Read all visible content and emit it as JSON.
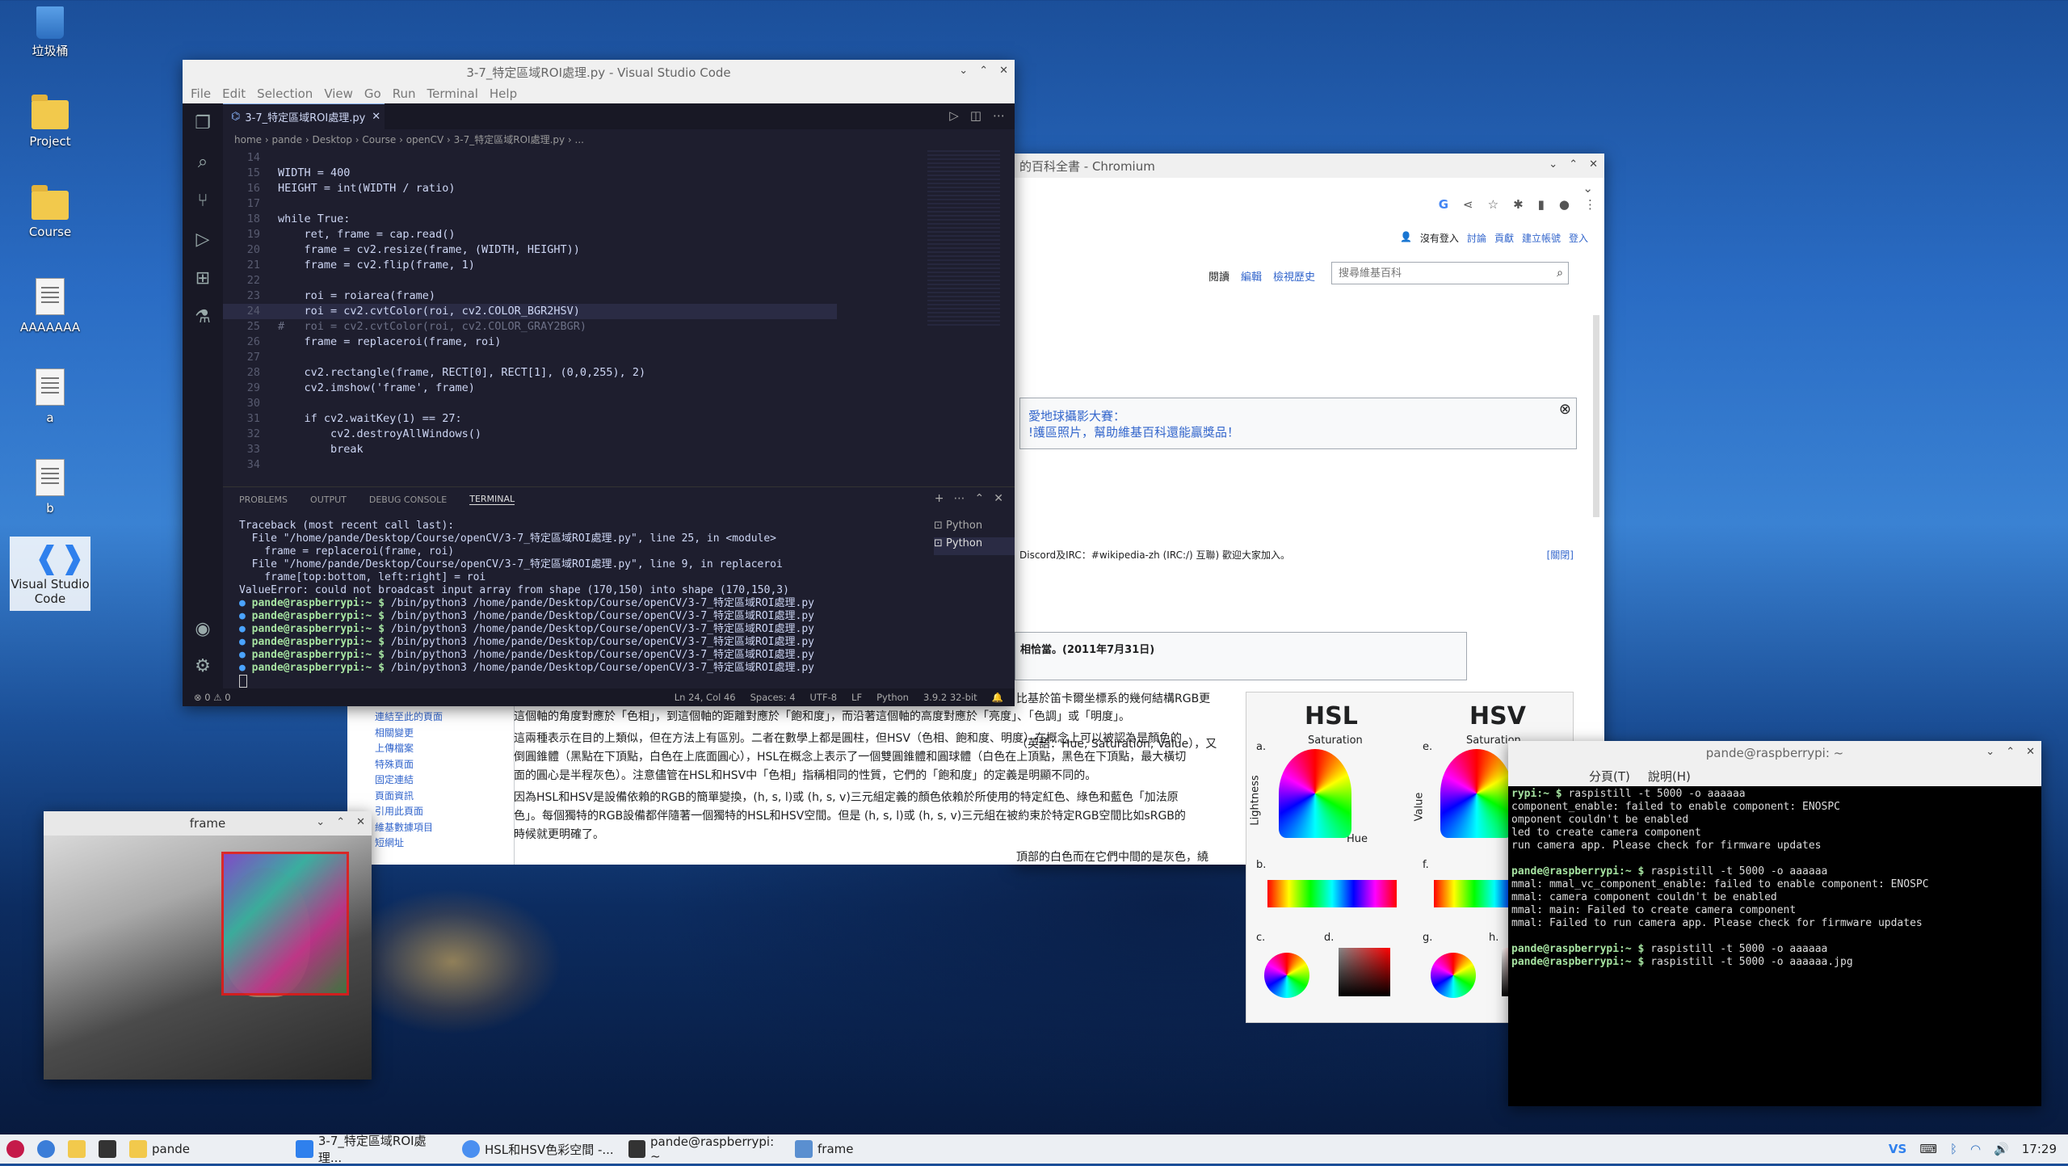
{
  "desktop": {
    "icons": [
      "垃圾桶",
      "Project",
      "Course",
      "AAAAAAA",
      "a",
      "b",
      "Visual Studio Code"
    ]
  },
  "vscode": {
    "title": "3-7_特定區域ROI處理.py - Visual Studio Code",
    "menu": [
      "File",
      "Edit",
      "Selection",
      "View",
      "Go",
      "Run",
      "Terminal",
      "Help"
    ],
    "tab": "3-7_特定區域ROI處理.py",
    "breadcrumb": "home › pande › Desktop › Course › openCV › 3-7_特定區域ROI處理.py › ...",
    "code_lines": [
      {
        "n": "14",
        "t": ""
      },
      {
        "n": "15",
        "t": "WIDTH = 400"
      },
      {
        "n": "16",
        "t": "HEIGHT = int(WIDTH / ratio)"
      },
      {
        "n": "17",
        "t": ""
      },
      {
        "n": "18",
        "t": "while True:"
      },
      {
        "n": "19",
        "t": "    ret, frame = cap.read()"
      },
      {
        "n": "20",
        "t": "    frame = cv2.resize(frame, (WIDTH, HEIGHT))"
      },
      {
        "n": "21",
        "t": "    frame = cv2.flip(frame, 1)"
      },
      {
        "n": "22",
        "t": ""
      },
      {
        "n": "23",
        "t": "    roi = roiarea(frame)"
      },
      {
        "n": "24",
        "t": "    roi = cv2.cvtColor(roi, cv2.COLOR_BGR2HSV)"
      },
      {
        "n": "25",
        "t": "#   roi = cv2.cvtColor(roi, cv2.COLOR_GRAY2BGR)"
      },
      {
        "n": "26",
        "t": "    frame = replaceroi(frame, roi)"
      },
      {
        "n": "27",
        "t": ""
      },
      {
        "n": "28",
        "t": "    cv2.rectangle(frame, RECT[0], RECT[1], (0,0,255), 2)"
      },
      {
        "n": "29",
        "t": "    cv2.imshow('frame', frame)"
      },
      {
        "n": "30",
        "t": ""
      },
      {
        "n": "31",
        "t": "    if cv2.waitKey(1) == 27:"
      },
      {
        "n": "32",
        "t": "        cv2.destroyAllWindows()"
      },
      {
        "n": "33",
        "t": "        break"
      },
      {
        "n": "34",
        "t": ""
      }
    ],
    "panel_tabs": [
      "PROBLEMS",
      "OUTPUT",
      "DEBUG CONSOLE",
      "TERMINAL"
    ],
    "terminal_lines": [
      "Traceback (most recent call last):",
      "  File \"/home/pande/Desktop/Course/openCV/3-7_特定區域ROI處理.py\", line 25, in <module>",
      "    frame = replaceroi(frame, roi)",
      "  File \"/home/pande/Desktop/Course/openCV/3-7_特定區域ROI處理.py\", line 9, in replaceroi",
      "    frame[top:bottom, left:right] = roi",
      "ValueError: could not broadcast input array from shape (170,150) into shape (170,150,3)"
    ],
    "prompt": "pande@raspberrypi:~ $",
    "prompt_cmd": " /bin/python3 /home/pande/Desktop/Course/openCV/3-7_特定區域ROI處理.py",
    "prompt_count": 6,
    "terminal_list": [
      "Python",
      "Python"
    ],
    "status": {
      "problems": "⊗ 0 ⚠ 0",
      "position": "Ln 24, Col 46",
      "spaces": "Spaces: 4",
      "encoding": "UTF-8",
      "eol": "LF",
      "lang": "Python",
      "interp": "3.9.2 32-bit"
    }
  },
  "chromium": {
    "title": "的百科全書 - Chromium",
    "user_links": [
      "沒有登入",
      "討論",
      "貢獻",
      "建立帳號",
      "登入"
    ],
    "tabs": [
      "閱讀",
      "編輯",
      "檢視歷史"
    ],
    "search_placeholder": "搜尋維基百科",
    "notice_line1": "愛地球攝影大賽：",
    "notice_line2": "!護區照片，幫助維基百科還能贏獎品！",
    "community": "Discord及IRC：#wikipedia-zh (IRC:/) 互聯) 歡迎大家加入。",
    "close_link": "[關閉]",
    "quote": "相恰當。(2011年7月31日)",
    "sidebar_links": [
      "連結至此的頁面",
      "相關變更",
      "上傳檔案",
      "特殊頁面",
      "固定連結",
      "頁面資訊",
      "引用此頁面",
      "維基數據項目",
      "短網址"
    ],
    "para_frag1": "比基於笛卡爾坐標系的幾何結構RGB更",
    "para_frag2": "（英語：Hue, Saturation, Value），又",
    "para_frag3": "頂部的白色而在它們中間的是灰色，繞",
    "paragraphs": [
      "這個軸的角度對應於「色相」，到這個軸的距離對應於「飽和度」，而沿著這個軸的高度對應於「亮度」、「色調」或「明度」。",
      "這兩種表示在目的上類似，但在方法上有區別。二者在數學上都是圓柱，但HSV（色相、飽和度、明度）在概念上可以被認為是顏色的倒圓錐體（黑點在下頂點，白色在上底面圓心），HSL在概念上表示了一個雙圓錐體和圓球體（白色在上頂點，黑色在下頂點，最大橫切面的圓心是半程灰色）。注意儘管在HSL和HSV中「色相」指稱相同的性質，它們的「飽和度」的定義是明顯不同的。",
      "因為HSL和HSV是設備依賴的RGB的簡單變換，(h, s, l)或 (h, s, v)三元組定義的顏色依賴於所使用的特定紅色、綠色和藍色「加法原色」。每個獨特的RGB設備都伴隨著一個獨特的HSL和HSV空間。但是 (h, s, l)或 (h, s, v)三元組在被約束於特定RGB空間比如sRGB的時候就更明確了。"
    ],
    "figure": {
      "left": "HSL",
      "right": "HSV",
      "sat": "Saturation",
      "light": "Lightness",
      "value": "Value",
      "hue": "Hue",
      "labels": [
        "a.",
        "b.",
        "c.",
        "d.",
        "e.",
        "f.",
        "g.",
        "h."
      ]
    }
  },
  "frame_window": {
    "title": "frame"
  },
  "lxterm": {
    "title": "pande@raspberrypi: ~",
    "menu": [
      "分頁(T)",
      "說明(H)"
    ],
    "lines": [
      {
        "p": "rypi:~ $",
        "c": " raspistill -t 5000 -o aaaaaa"
      },
      {
        "p": "",
        "c": "component_enable: failed to enable component: ENOSPC"
      },
      {
        "p": "",
        "c": "omponent couldn't be enabled"
      },
      {
        "p": "",
        "c": "led to create camera component"
      },
      {
        "p": "",
        "c": "run camera app. Please check for firmware updates"
      },
      {
        "p": "",
        "c": ""
      },
      {
        "p": "pande@raspberrypi:~ $",
        "c": " raspistill -t 5000 -o aaaaaa"
      },
      {
        "p": "",
        "c": "mmal: mmal_vc_component_enable: failed to enable component: ENOSPC"
      },
      {
        "p": "",
        "c": "mmal: camera component couldn't be enabled"
      },
      {
        "p": "",
        "c": "mmal: main: Failed to create camera component"
      },
      {
        "p": "",
        "c": "mmal: Failed to run camera app. Please check for firmware updates"
      },
      {
        "p": "",
        "c": ""
      },
      {
        "p": "pande@raspberrypi:~ $",
        "c": " raspistill -t 5000 -o aaaaaa"
      },
      {
        "p": "pande@raspberrypi:~ $",
        "c": " raspistill -t 5000 -o aaaaaa.jpg"
      }
    ]
  },
  "taskbar": {
    "items": [
      "pande",
      "3-7_特定區域ROI處理...",
      "HSL和HSV色彩空間 -...",
      "pande@raspberrypi: ~",
      "frame"
    ],
    "clock": "17:29"
  },
  "colors": {
    "vscode_bg": "#1e1e2e",
    "accent": "#89b4fa",
    "prompt": "#a6e3a1",
    "link": "#3366cc"
  }
}
